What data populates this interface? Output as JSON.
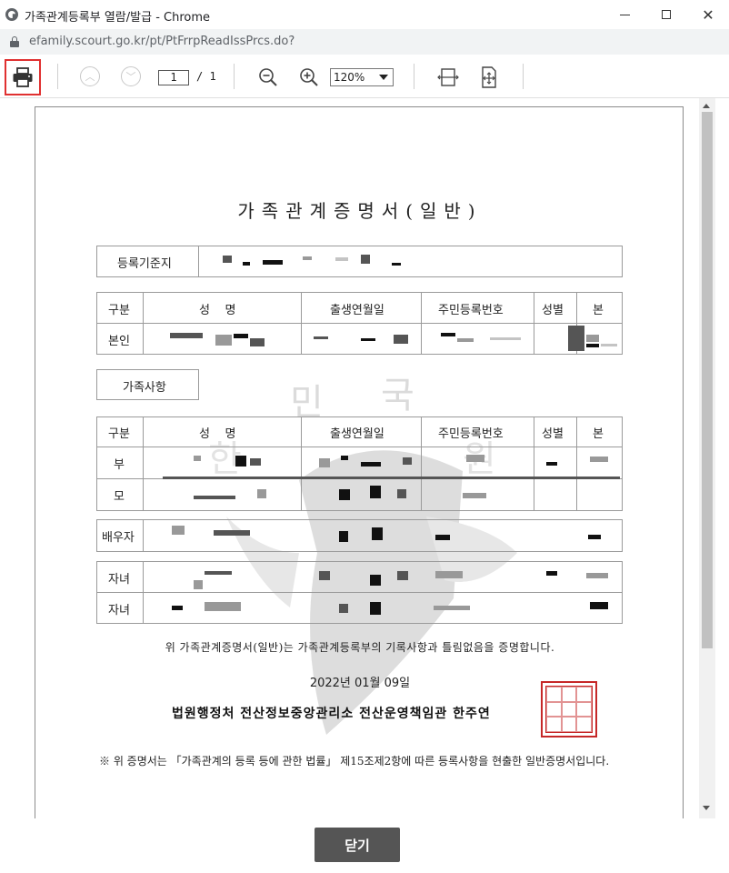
{
  "window": {
    "title": "가족관계등록부 열람/발급 - Chrome",
    "url": "efamily.scourt.go.kr/pt/PtFrrpReadIssPrcs.do?"
  },
  "toolbar": {
    "page_current": "1",
    "page_total": "/ 1",
    "zoom": "120%"
  },
  "document": {
    "title": "가족관계증명서(일반)",
    "registration_label": "등록기준지",
    "table_headers": {
      "category": "구분",
      "name": "성    명",
      "birth": "출생연월일",
      "resident_no": "주민등록번호",
      "sex": "성별",
      "origin": "본"
    },
    "self_label": "본인",
    "family_section_label": "가족사항",
    "family_rows": [
      "부",
      "모",
      "배우자",
      "자녀",
      "자녀"
    ],
    "statement": "위 가족관계증명서(일반)는 가족관계등록부의 기록사항과 틀림없음을 증명합니다.",
    "date": "2022년 01월 09일",
    "issuer": "법원행정처 전산정보중앙관리소 전산운영책임관 한주연",
    "note": "※ 위 증명서는 「가족관계의 등록 등에 관한 법률」 제15조제2항에 따른 등록사항을 현출한 일반증명서입니다."
  },
  "footer": {
    "close_label": "닫기"
  },
  "colors": {
    "print_highlight": "#e03030",
    "seal": "#c62828",
    "close_button": "#555555"
  }
}
